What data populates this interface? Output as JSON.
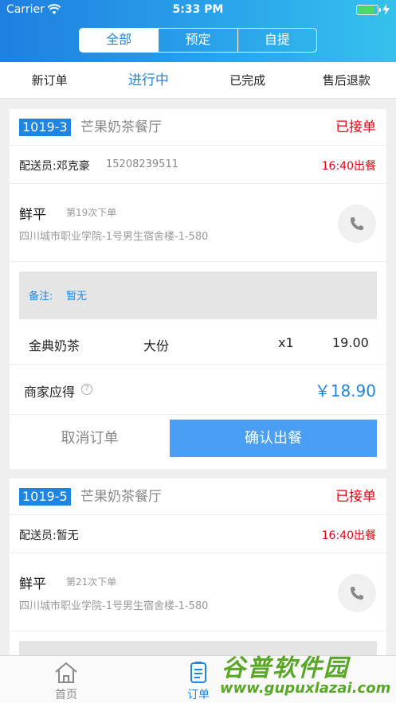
{
  "status_bar": {
    "carrier": "Carrier",
    "time": "5:33 PM",
    "battery_level": 0.8
  },
  "segments": [
    {
      "label": "全部",
      "active": true
    },
    {
      "label": "预定",
      "active": false
    },
    {
      "label": "自提",
      "active": false
    }
  ],
  "tabs": [
    {
      "label": "新订单",
      "active": false
    },
    {
      "label": "进行中",
      "active": true
    },
    {
      "label": "已完成",
      "active": false
    },
    {
      "label": "售后退款",
      "active": false
    }
  ],
  "orders": [
    {
      "order_no": "1019-3",
      "shop": "芒果奶茶餐厅",
      "status": "已接单",
      "courier": "配送员:邓克豪",
      "courier_phone": "15208239511",
      "ready_time": "16:40出餐",
      "customer_name": "鲜平",
      "order_count": "第19次下单",
      "address": "四川城市职业学院-1号男生宿舍楼-1-580",
      "note_label": "备注:",
      "note_value": "暂无",
      "item": {
        "name": "金典奶茶",
        "size": "大份",
        "qty": "x1",
        "price": "19.00"
      },
      "earn_label": "商家应得",
      "help_icon": "?",
      "earn_amount": "￥18.90",
      "cancel_label": "取消订单",
      "confirm_label": "确认出餐"
    },
    {
      "order_no": "1019-5",
      "shop": "芒果奶茶餐厅",
      "status": "已接单",
      "courier": "配送员:暂无",
      "ready_time": "16:40出餐",
      "customer_name": "鲜平",
      "order_count": "第21次下单",
      "address": "四川城市职业学院-1号男生宿舍楼-1-580"
    }
  ],
  "tabbar": [
    {
      "label": "首页",
      "icon": "home-icon",
      "active": false
    },
    {
      "label": "订单",
      "icon": "order-list-icon",
      "active": true
    }
  ],
  "watermark": {
    "title": "谷普软件园",
    "url": "www.gupuxlazai.com"
  },
  "colors": {
    "accent": "#1e86e2",
    "alert": "#e60012",
    "confirm_button": "#4a9ff5"
  }
}
